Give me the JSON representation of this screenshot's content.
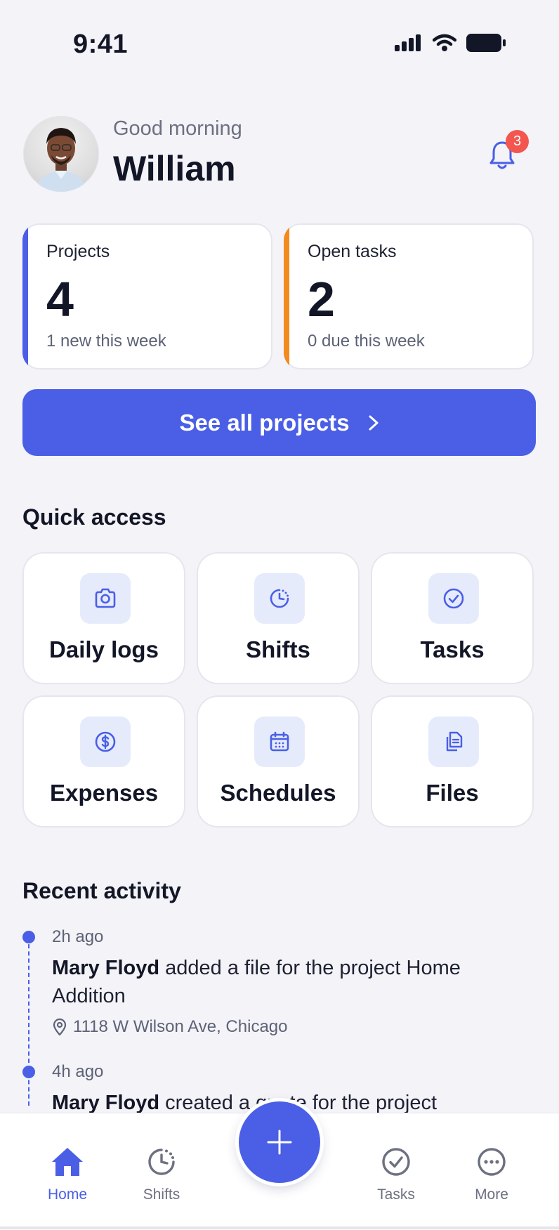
{
  "status_bar": {
    "time": "9:41"
  },
  "header": {
    "greeting": "Good morning",
    "name": "William",
    "notification_count": "3"
  },
  "stats": [
    {
      "label": "Projects",
      "value": "4",
      "sub": "1 new this week",
      "color": "#4a5fe6"
    },
    {
      "label": "Open tasks",
      "value": "2",
      "sub": "0 due this week",
      "color": "#f28a1e"
    }
  ],
  "see_all_label": "See all projects",
  "quick_access": {
    "title": "Quick access",
    "items": [
      {
        "label": "Daily logs",
        "icon": "camera-icon"
      },
      {
        "label": "Shifts",
        "icon": "clock-icon"
      },
      {
        "label": "Tasks",
        "icon": "check-circle-icon"
      },
      {
        "label": "Expenses",
        "icon": "dollar-icon"
      },
      {
        "label": "Schedules",
        "icon": "calendar-icon"
      },
      {
        "label": "Files",
        "icon": "files-icon"
      }
    ]
  },
  "recent_activity": {
    "title": "Recent activity",
    "items": [
      {
        "time": "2h ago",
        "actor": "Mary Floyd",
        "action": " added a file for the project Home Addition",
        "location": "1118 W Wilson Ave, Chicago"
      },
      {
        "time": "4h ago",
        "actor": "Mary Floyd",
        "action": " created a quote for the project"
      }
    ]
  },
  "tabbar": {
    "items": [
      {
        "label": "Home",
        "icon": "home-icon",
        "active": true
      },
      {
        "label": "Shifts",
        "icon": "clock-icon",
        "active": false
      },
      {
        "label": "Tasks",
        "icon": "check-circle-icon",
        "active": false
      },
      {
        "label": "More",
        "icon": "more-icon",
        "active": false
      }
    ],
    "fab_icon": "plus-icon"
  },
  "colors": {
    "accent": "#4a5fe6",
    "orange": "#f28a1e",
    "badge": "#f2564e",
    "background": "#f3f3f8"
  }
}
